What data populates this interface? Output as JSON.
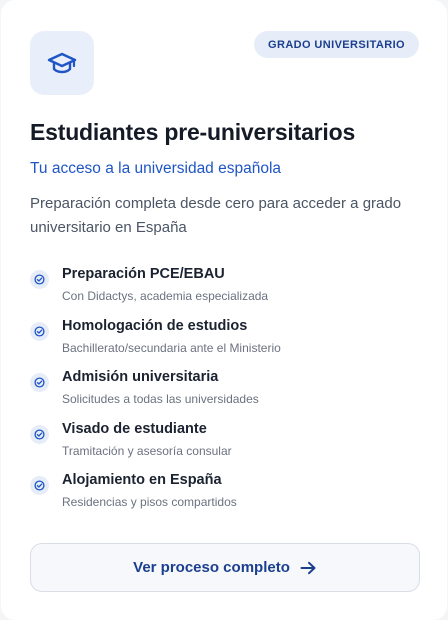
{
  "card": {
    "badge": "GRADO UNIVERSITARIO",
    "icon": "graduation-cap-icon",
    "title": "Estudiantes pre-universitarios",
    "subtitle": "Tu acceso a la universidad española",
    "description": "Preparación completa desde cero para acceder a grado universitario en España",
    "features": [
      {
        "title": "Preparación PCE/EBAU",
        "subtitle": "Con Didactys, academia especializada"
      },
      {
        "title": "Homologación de estudios",
        "subtitle": "Bachillerato/secundaria ante el Ministerio"
      },
      {
        "title": "Admisión universitaria",
        "subtitle": "Solicitudes a todas las universidades"
      },
      {
        "title": "Visado de estudiante",
        "subtitle": "Tramitación y asesoría consular"
      },
      {
        "title": "Alojamiento en España",
        "subtitle": "Residencias y pisos compartidos"
      }
    ],
    "cta_label": "Ver proceso completo",
    "cta_icon": "arrow-right-icon",
    "feature_icon": "check-circle-icon"
  },
  "colors": {
    "accent": "#1f55c4",
    "accent_dark": "#1b3f8f",
    "accent_bg": "#e7edf8"
  }
}
